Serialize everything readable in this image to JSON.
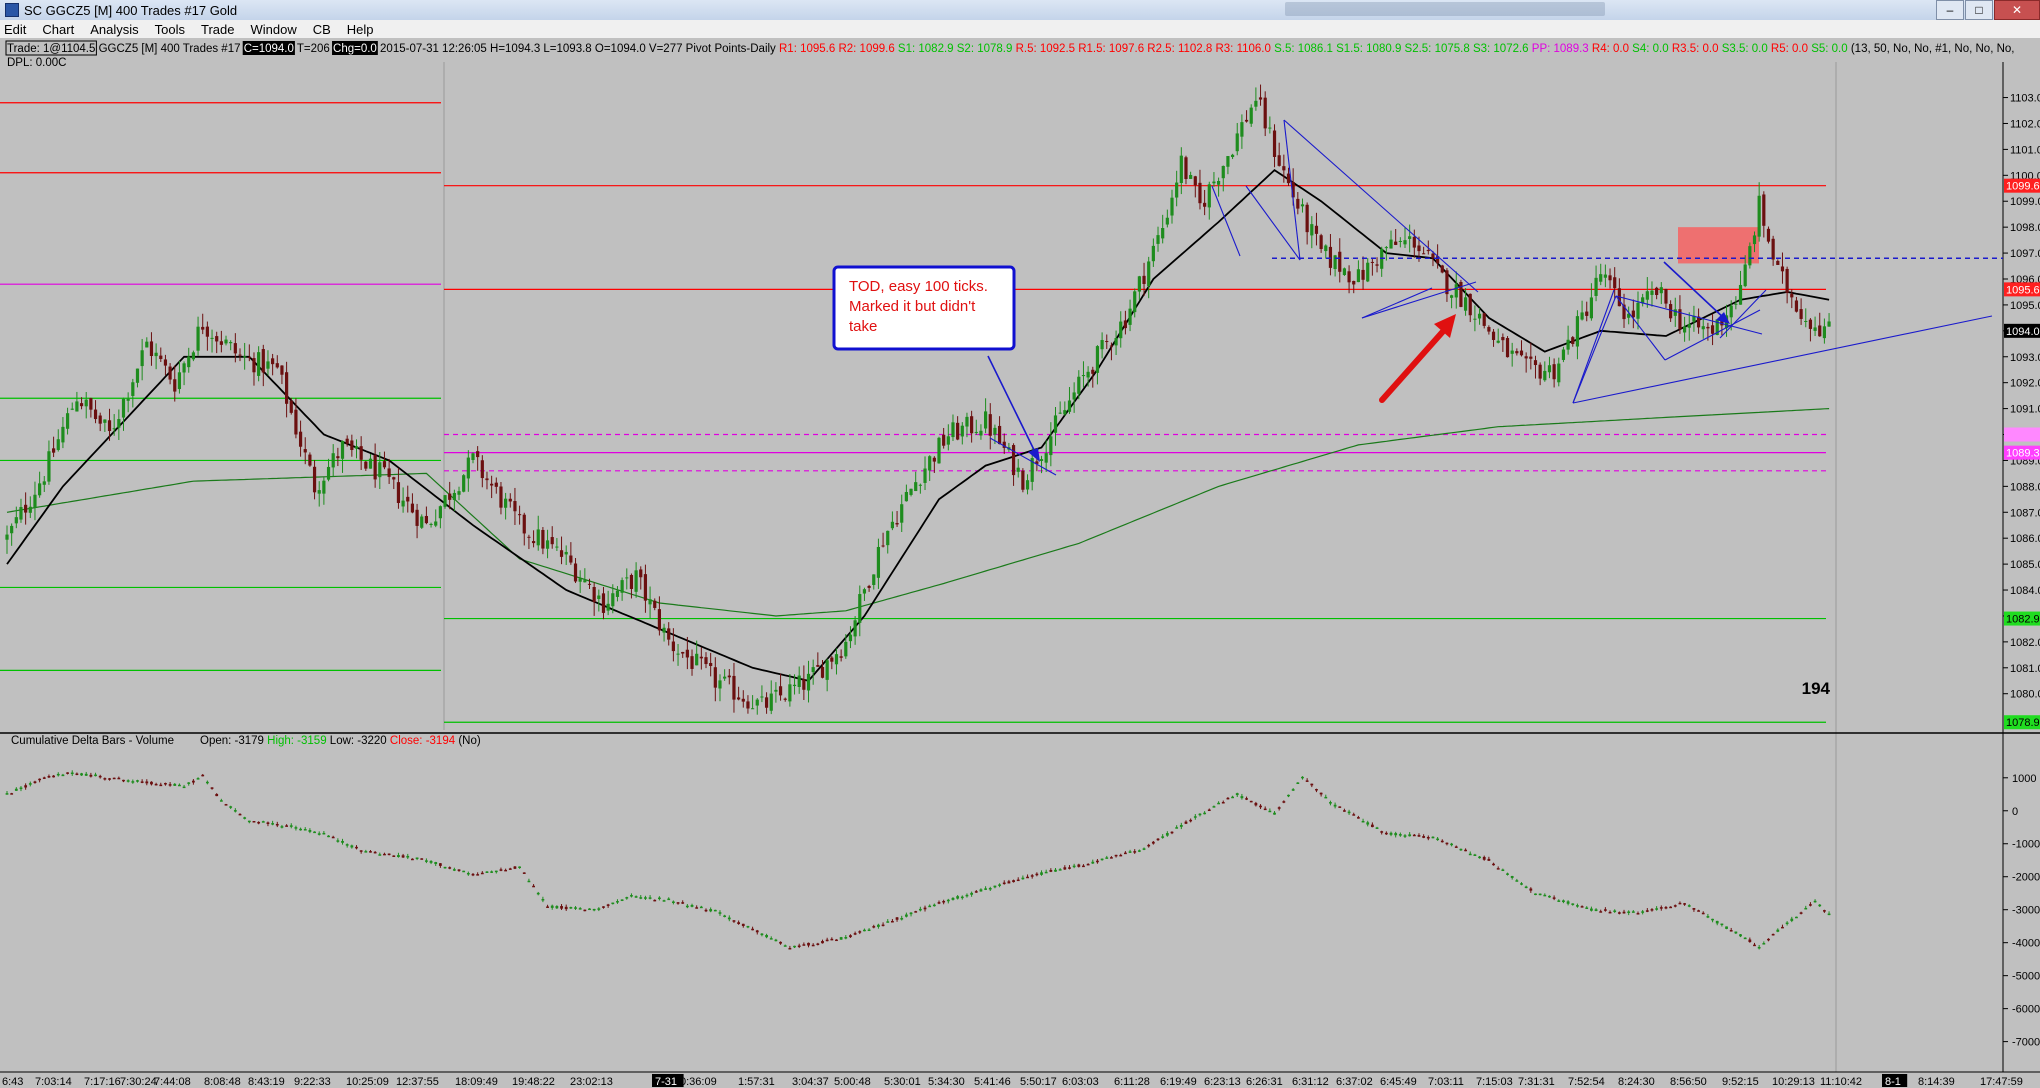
{
  "window": {
    "title": "SC GGCZ5 [M]  400 Trades  #17  Gold",
    "controls": [
      "–",
      "□",
      "✕"
    ]
  },
  "menu": [
    "Edit",
    "Chart",
    "Analysis",
    "Tools",
    "Trade",
    "Window",
    "CB",
    "Help"
  ],
  "header": {
    "row1": [
      {
        "t": "Trade: 1@1104.5",
        "c": "#000000",
        "box": true
      },
      {
        "t": " GGCZ5 [M]  400 Trades  #17 ",
        "c": "#000000"
      },
      {
        "t": "C=1094.0",
        "c": "#ffffff",
        "bg": "#000000"
      },
      {
        "t": "  T=206 ",
        "c": "#000000"
      },
      {
        "t": "Chg=0.0",
        "c": "#ffffff",
        "bg": "#000000"
      },
      {
        "t": "  2015-07-31 12:26:05  H=1094.3  L=1093.8  O=1094.0  V=277  Pivot Points-Daily  ",
        "c": "#000000"
      },
      {
        "t": "R1: 1095.6  R2: 1099.6  ",
        "c": "#ff0000"
      },
      {
        "t": "S1: 1082.9  S2: 1078.9  ",
        "c": "#00c000"
      },
      {
        "t": "R.5: 1092.5  R1.5: 1097.6  R2.5: 1102.8  R3: 1106.0  ",
        "c": "#ff0000"
      },
      {
        "t": "S.5: 1086.1  S1.5: 1080.9  S2.5: 1075.8  S3: 1072.6  ",
        "c": "#00c000"
      },
      {
        "t": "PP: 1089.3  ",
        "c": "#e000e0"
      },
      {
        "t": "R4: 0.0  ",
        "c": "#ff0000"
      },
      {
        "t": "S4: 0.0  ",
        "c": "#00c000"
      },
      {
        "t": "R3.5: 0.0  ",
        "c": "#ff0000"
      },
      {
        "t": "S3.5: 0.0  ",
        "c": "#00c000"
      },
      {
        "t": "R5: 0.0  ",
        "c": "#ff0000"
      },
      {
        "t": "S5: 0.0  ",
        "c": "#00c000"
      },
      {
        "t": "(13, 50, No, No, #1, No, No, No,",
        "c": "#000000"
      }
    ],
    "row2": "DPL: 0.00C"
  },
  "annotation": {
    "callout": [
      "TOD, easy 100 ticks.",
      "Marked it but didn't",
      "take"
    ],
    "count": "194"
  },
  "colors": {
    "bg": "#c0c0c0",
    "resistance": "#ff0000",
    "support": "#00c000",
    "pivot": "#e000e0",
    "up": "#1e8c1e",
    "down": "#6b1010",
    "ma_fast": "#000000",
    "ma_slow": "#1a7a1a",
    "trendline": "#1a1acc",
    "arrow": "#e01010",
    "zone": "#f06b6b"
  },
  "price_labels": [
    {
      "v": 1099.6,
      "t": "1099.6",
      "bg": "#ff2020",
      "fg": "#ffffff"
    },
    {
      "v": 1095.6,
      "t": "1095.6",
      "bg": "#ff2020",
      "fg": "#ffffff"
    },
    {
      "v": 1094.0,
      "t": "1094.0",
      "bg": "#000000",
      "fg": "#ffffff"
    },
    {
      "v": 1090.0,
      "t": "",
      "bg": "#ff88ff",
      "fg": "#000000"
    },
    {
      "v": 1089.3,
      "t": "1089.3",
      "bg": "#ff40ff",
      "fg": "#ffffff"
    },
    {
      "v": 1082.9,
      "t": "1082.9",
      "bg": "#20dd20",
      "fg": "#000000"
    },
    {
      "v": 1078.9,
      "t": "1078.9",
      "bg": "#20dd20",
      "fg": "#000000"
    }
  ],
  "delta_panel": {
    "title": "Cumulative Delta Bars - Volume",
    "parts": [
      {
        "t": "Open: -3179  ",
        "c": "#000000"
      },
      {
        "t": "High: -3159  ",
        "c": "#00c000"
      },
      {
        "t": "Low: -3220  ",
        "c": "#000000"
      },
      {
        "t": "Close: -3194  ",
        "c": "#ff0000"
      },
      {
        "t": "(No)",
        "c": "#000000"
      }
    ]
  },
  "time_axis": {
    "labels": [
      "6:43",
      "7:03:14",
      "7:17:16",
      "7:30:24",
      "7:44:08",
      "8:08:48",
      "8:43:19",
      "9:22:33",
      "10:25:09",
      "12:37:55",
      "18:09:49",
      "19:48:22",
      "23:02:13",
      "7-31",
      "0:36:09",
      "1:57:31",
      "3:04:37",
      "5:00:48",
      "5:30:01",
      "5:34:30",
      "5:41:46",
      "5:50:17",
      "6:03:03",
      "6:11:28",
      "6:19:49",
      "6:23:13",
      "6:26:31",
      "6:31:12",
      "6:37:02",
      "6:45:49",
      "7:03:11",
      "7:15:03",
      "7:31:31",
      "7:52:54",
      "8:24:30",
      "8:56:50",
      "9:52:15",
      "10:29:13",
      "11:10:42",
      "8-1",
      "8:14:39",
      "17:47:59"
    ]
  },
  "chart_data": [
    {
      "type": "candlestick",
      "title": "GGCZ5 [M] 400 Trades #17 Gold",
      "y_ticks": [
        "1103.0",
        "1102.0",
        "1101.0",
        "1100.0",
        "1099.0",
        "1098.0",
        "1097.0",
        "1096.0",
        "1095.0",
        "1094.0",
        "1093.0",
        "1092.0",
        "1091.0",
        "1090.0",
        "1089.0",
        "1088.0",
        "1087.0",
        "1086.0",
        "1085.0",
        "1084.0",
        "1083.0",
        "1082.0",
        "1081.0",
        "1080.0"
      ],
      "ylim": [
        1078.6,
        1103.6
      ],
      "price_path": [
        [
          0,
          1086
        ],
        [
          8,
          1088.5
        ],
        [
          15,
          1091.5
        ],
        [
          22,
          1090
        ],
        [
          30,
          1093.5
        ],
        [
          36,
          1092
        ],
        [
          42,
          1094.3
        ],
        [
          50,
          1093
        ],
        [
          58,
          1092.5
        ],
        [
          66,
          1088
        ],
        [
          72,
          1089.5
        ],
        [
          80,
          1088.5
        ],
        [
          90,
          1086.5
        ],
        [
          100,
          1089
        ],
        [
          110,
          1086.5
        ],
        [
          120,
          1085.2
        ],
        [
          128,
          1083.5
        ],
        [
          135,
          1084.5
        ],
        [
          142,
          1082
        ],
        [
          152,
          1080.5
        ],
        [
          162,
          1079.5
        ],
        [
          172,
          1080.5
        ],
        [
          180,
          1082
        ],
        [
          188,
          1086
        ],
        [
          196,
          1088.5
        ],
        [
          202,
          1090
        ],
        [
          210,
          1090.5
        ],
        [
          218,
          1088.3
        ],
        [
          224,
          1090
        ],
        [
          232,
          1092.5
        ],
        [
          240,
          1094.5
        ],
        [
          248,
          1098
        ],
        [
          252,
          1100.5
        ],
        [
          256,
          1098.8
        ],
        [
          262,
          1100.8
        ],
        [
          268,
          1103
        ],
        [
          272,
          1101
        ],
        [
          276,
          1099.2
        ],
        [
          282,
          1097
        ],
        [
          290,
          1096
        ],
        [
          296,
          1097.2
        ],
        [
          302,
          1097.5
        ],
        [
          308,
          1096
        ],
        [
          314,
          1095
        ],
        [
          320,
          1093.5
        ],
        [
          326,
          1092.5
        ],
        [
          332,
          1092.5
        ],
        [
          338,
          1094.5
        ],
        [
          342,
          1096.2
        ],
        [
          348,
          1094.5
        ],
        [
          354,
          1095.5
        ],
        [
          360,
          1094.2
        ],
        [
          366,
          1094
        ],
        [
          372,
          1095.5
        ],
        [
          376,
          1098.8
        ],
        [
          380,
          1096.2
        ],
        [
          386,
          1094.5
        ],
        [
          391,
          1094
        ]
      ],
      "ma_fast": [
        [
          0,
          1085
        ],
        [
          12,
          1088
        ],
        [
          25,
          1090.5
        ],
        [
          38,
          1093
        ],
        [
          52,
          1093
        ],
        [
          68,
          1090
        ],
        [
          82,
          1089
        ],
        [
          100,
          1086.5
        ],
        [
          120,
          1084
        ],
        [
          140,
          1082.5
        ],
        [
          160,
          1081
        ],
        [
          172,
          1080.5
        ],
        [
          184,
          1083
        ],
        [
          200,
          1087.5
        ],
        [
          210,
          1088.8
        ],
        [
          222,
          1089.5
        ],
        [
          234,
          1092.5
        ],
        [
          246,
          1096
        ],
        [
          260,
          1098.2
        ],
        [
          272,
          1100.2
        ],
        [
          282,
          1099
        ],
        [
          296,
          1097
        ],
        [
          306,
          1096.8
        ],
        [
          318,
          1094.5
        ],
        [
          330,
          1093.2
        ],
        [
          342,
          1094
        ],
        [
          356,
          1093.8
        ],
        [
          372,
          1095.2
        ],
        [
          382,
          1095.5
        ],
        [
          391,
          1095.2
        ]
      ],
      "ma_slow": [
        [
          0,
          1087
        ],
        [
          40,
          1088.2
        ],
        [
          90,
          1088.5
        ],
        [
          110,
          1085.2
        ],
        [
          140,
          1083.5
        ],
        [
          165,
          1083
        ],
        [
          180,
          1083.2
        ],
        [
          200,
          1084.2
        ],
        [
          230,
          1085.8
        ],
        [
          260,
          1088
        ],
        [
          290,
          1089.6
        ],
        [
          320,
          1090.3
        ],
        [
          360,
          1090.7
        ],
        [
          391,
          1091
        ]
      ],
      "levels": [
        {
          "v": 1102.8,
          "kind": "resistance",
          "seg": 0
        },
        {
          "v": 1100.1,
          "kind": "resistance",
          "seg": 0
        },
        {
          "v": 1095.8,
          "kind": "pivot",
          "seg": 0
        },
        {
          "v": 1091.4,
          "kind": "support",
          "seg": 0
        },
        {
          "v": 1089.0,
          "kind": "support",
          "seg": 0
        },
        {
          "v": 1084.1,
          "kind": "support",
          "seg": 0
        },
        {
          "v": 1080.9,
          "kind": "support",
          "seg": 0
        },
        {
          "v": 1099.6,
          "kind": "resistance",
          "seg": 1
        },
        {
          "v": 1095.6,
          "kind": "resistance",
          "seg": 1
        },
        {
          "v": 1090.0,
          "kind": "pivot-dash",
          "seg": 1
        },
        {
          "v": 1089.3,
          "kind": "pivot",
          "seg": 1
        },
        {
          "v": 1088.6,
          "kind": "pivot-dash",
          "seg": 1
        },
        {
          "v": 1082.9,
          "kind": "support",
          "seg": 1
        },
        {
          "v": 1078.9,
          "kind": "support",
          "seg": 1
        }
      ],
      "dashed_level": 1096.8
    },
    {
      "type": "bar",
      "title": "Cumulative Delta Bars - Volume",
      "y_ticks": [
        "1000",
        "0",
        "-1000",
        "-2000",
        "-3000",
        "-4000",
        "-5000",
        "-6000",
        "-7000"
      ],
      "ylim": [
        -7800,
        1600
      ],
      "path": [
        [
          0,
          500
        ],
        [
          8,
          1000
        ],
        [
          14,
          1150
        ],
        [
          22,
          1000
        ],
        [
          30,
          850
        ],
        [
          38,
          750
        ],
        [
          42,
          1050
        ],
        [
          46,
          300
        ],
        [
          52,
          -300
        ],
        [
          60,
          -450
        ],
        [
          68,
          -700
        ],
        [
          76,
          -1200
        ],
        [
          90,
          -1500
        ],
        [
          100,
          -1950
        ],
        [
          110,
          -1700
        ],
        [
          116,
          -2900
        ],
        [
          126,
          -3000
        ],
        [
          134,
          -2600
        ],
        [
          142,
          -2700
        ],
        [
          152,
          -3050
        ],
        [
          168,
          -4150
        ],
        [
          180,
          -3850
        ],
        [
          200,
          -2800
        ],
        [
          212,
          -2300
        ],
        [
          222,
          -1900
        ],
        [
          232,
          -1600
        ],
        [
          244,
          -1150
        ],
        [
          256,
          -100
        ],
        [
          264,
          500
        ],
        [
          272,
          -100
        ],
        [
          278,
          1050
        ],
        [
          284,
          250
        ],
        [
          296,
          -700
        ],
        [
          306,
          -800
        ],
        [
          318,
          -1500
        ],
        [
          328,
          -2500
        ],
        [
          340,
          -3000
        ],
        [
          350,
          -3100
        ],
        [
          360,
          -2800
        ],
        [
          366,
          -3300
        ],
        [
          376,
          -4100
        ],
        [
          384,
          -3200
        ],
        [
          388,
          -2750
        ],
        [
          391,
          -3150
        ]
      ]
    }
  ]
}
